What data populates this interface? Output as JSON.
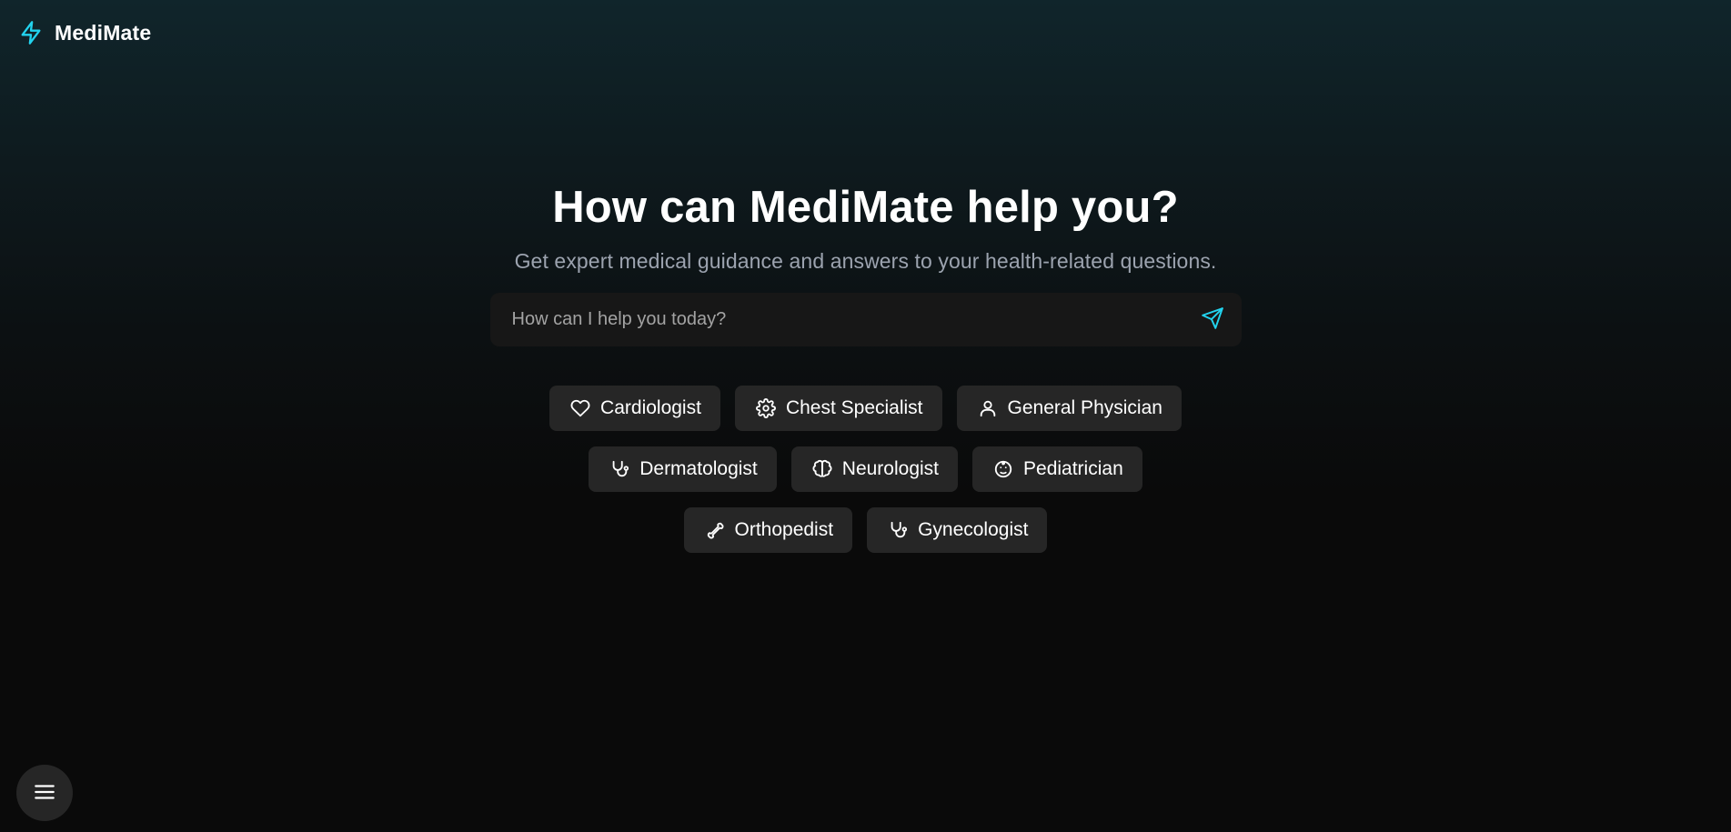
{
  "brand": {
    "name": "MediMate",
    "icon": "lightning-bolt-icon",
    "accent_color": "#22d3ee"
  },
  "hero": {
    "title": "How can MediMate help you?",
    "subtitle": "Get expert medical guidance and answers to your health-related questions."
  },
  "search": {
    "placeholder": "How can I help you today?",
    "value": "",
    "send_icon": "send-icon"
  },
  "chips": [
    {
      "label": "Cardiologist",
      "icon": "heart-icon"
    },
    {
      "label": "Chest Specialist",
      "icon": "gear-icon"
    },
    {
      "label": "General Physician",
      "icon": "user-icon"
    },
    {
      "label": "Dermatologist",
      "icon": "stethoscope-icon"
    },
    {
      "label": "Neurologist",
      "icon": "brain-icon"
    },
    {
      "label": "Pediatrician",
      "icon": "baby-icon"
    },
    {
      "label": "Orthopedist",
      "icon": "bone-icon"
    },
    {
      "label": "Gynecologist",
      "icon": "stethoscope-icon"
    }
  ],
  "menu": {
    "icon": "menu-icon"
  },
  "colors": {
    "chip_background": "#262626",
    "search_background": "#171717",
    "subtitle_text": "#9ca3af"
  }
}
